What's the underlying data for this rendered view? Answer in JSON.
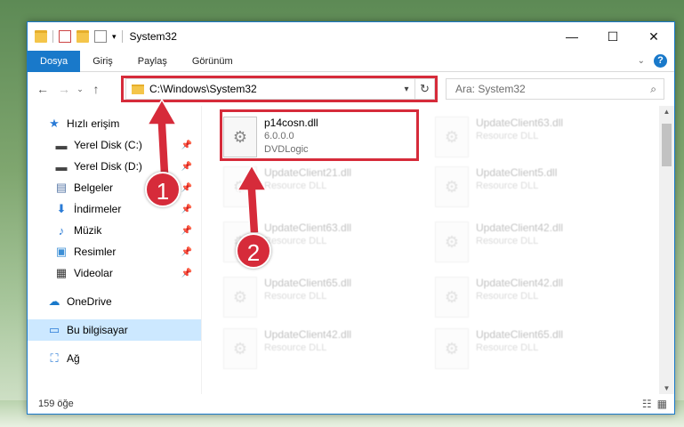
{
  "window": {
    "title": "System32",
    "controls": {
      "minimize": "—",
      "maximize": "☐",
      "close": "✕"
    }
  },
  "ribbon": {
    "tabs": [
      "Dosya",
      "Giriş",
      "Paylaş",
      "Görünüm"
    ],
    "help": "?"
  },
  "address": {
    "path": "C:\\Windows\\System32",
    "search_placeholder": "Ara: System32"
  },
  "nav": {
    "quick_access": "Hızlı erişim",
    "pinned": [
      {
        "label": "Yerel Disk (C:)",
        "icon": "drive-icon"
      },
      {
        "label": "Yerel Disk (D:)",
        "icon": "drive-icon"
      },
      {
        "label": "Belgeler",
        "icon": "documents-icon"
      },
      {
        "label": "İndirmeler",
        "icon": "downloads-icon"
      },
      {
        "label": "Müzik",
        "icon": "music-icon"
      },
      {
        "label": "Resimler",
        "icon": "pictures-icon"
      },
      {
        "label": "Videolar",
        "icon": "videos-icon"
      }
    ],
    "onedrive": "OneDrive",
    "this_pc": "Bu bilgisayar",
    "network": "Ağ"
  },
  "files": [
    {
      "name": "p14cosn.dll",
      "line2": "6.0.0.0",
      "line3": "DVDLogic",
      "highlighted": true
    },
    {
      "name": "UpdateClient63.dll",
      "line2": "Resource DLL"
    },
    {
      "name": "UpdateClient21.dll",
      "line2": "Resource DLL"
    },
    {
      "name": "UpdateClient5.dll",
      "line2": "Resource DLL"
    },
    {
      "name": "UpdateClient63.dll",
      "line2": "Resource DLL"
    },
    {
      "name": "UpdateClient42.dll",
      "line2": "Resource DLL"
    },
    {
      "name": "UpdateClient65.dll",
      "line2": "Resource DLL"
    },
    {
      "name": "UpdateClient42.dll",
      "line2": "Resource DLL"
    },
    {
      "name": "UpdateClient42.dll",
      "line2": "Resource DLL"
    },
    {
      "name": "UpdateClient65.dll",
      "line2": "Resource DLL"
    }
  ],
  "status": {
    "count": "159 öğe"
  },
  "annotations": {
    "step1": "1",
    "step2": "2",
    "color": "#d62b3a"
  }
}
